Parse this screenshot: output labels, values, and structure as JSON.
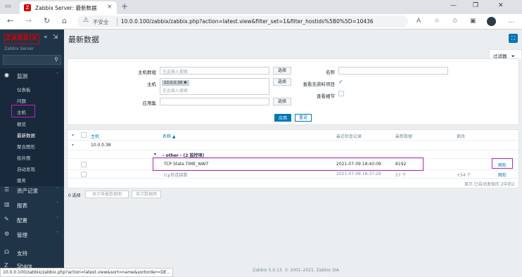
{
  "browser": {
    "tab_title": "Zabbix Server: 最新数据",
    "tab_favicon": "Z",
    "insecure_label": "不安全",
    "url": "10.0.0.100/zabbix/zabbix.php?action=latest.view&filter_set=1&filter_hostids%5B0%5D=10436",
    "new_tab": "+",
    "status_url": "10.0.0.100/zabbix/zabbix.php?action=latest.view&sort=name&sortorder=DE..."
  },
  "sidebar": {
    "logo": "ZABBIX",
    "server_name": "Zabbix Server",
    "menu": {
      "monitoring": "监测",
      "inventory": "资产记录",
      "reports": "报表",
      "configuration": "配置",
      "administration": "管理",
      "support": "支持",
      "share": "Share"
    },
    "monitoring_items": [
      "仪表板",
      "问题",
      "主机",
      "概览",
      "最新数据",
      "聚合图形",
      "拓扑图",
      "自动发现",
      "服务"
    ]
  },
  "page": {
    "title": "最新数据",
    "filter_tab": "过滤器"
  },
  "filter": {
    "host_groups_label": "主机群组",
    "host_groups_placeholder": "在此输入搜索",
    "hosts_label": "主机",
    "host_chip": "10.0.0.38",
    "hosts_placeholder": "在此输入搜索",
    "application_label": "应用集",
    "select_label": "选择",
    "name_label": "名称",
    "show_without_data_label": "查看无资料项目",
    "show_details_label": "查看细节",
    "apply_label": "应用",
    "reset_label": "重设"
  },
  "table": {
    "headers": {
      "host": "主机",
      "name": "名称 ▲",
      "last_check": "最近检查记录",
      "last_value": "最新数据",
      "change": "更改"
    },
    "host_group": "10.0.0.38",
    "app_group": "- other - (2 监控项)",
    "rows": [
      {
        "name": "TCP State TIME_WAIT",
        "last_check": "2021-07-09 18:40:09",
        "last_value": "8192",
        "change": "",
        "action": "图形"
      },
      {
        "name": "tcp的连接数",
        "last_check": "2021-07-09 18:37:29",
        "last_value": "57 个",
        "change": "+54 个",
        "action": "图形"
      }
    ],
    "summary": "显示 已自动发现的 2中的2"
  },
  "bulk": {
    "selected": "0 选择",
    "stack_graph": "显示堆叠数据图",
    "display_graph": "显示数据图"
  },
  "footer": {
    "copyright": "Zabbix 5.0.13. © 2001–2021, Zabbix SIA"
  },
  "colors": {
    "brand_red": "#d40000",
    "link_blue": "#0275b8",
    "sidebar_bg": "#1f3547",
    "highlight_magenta": "#c020c0"
  }
}
